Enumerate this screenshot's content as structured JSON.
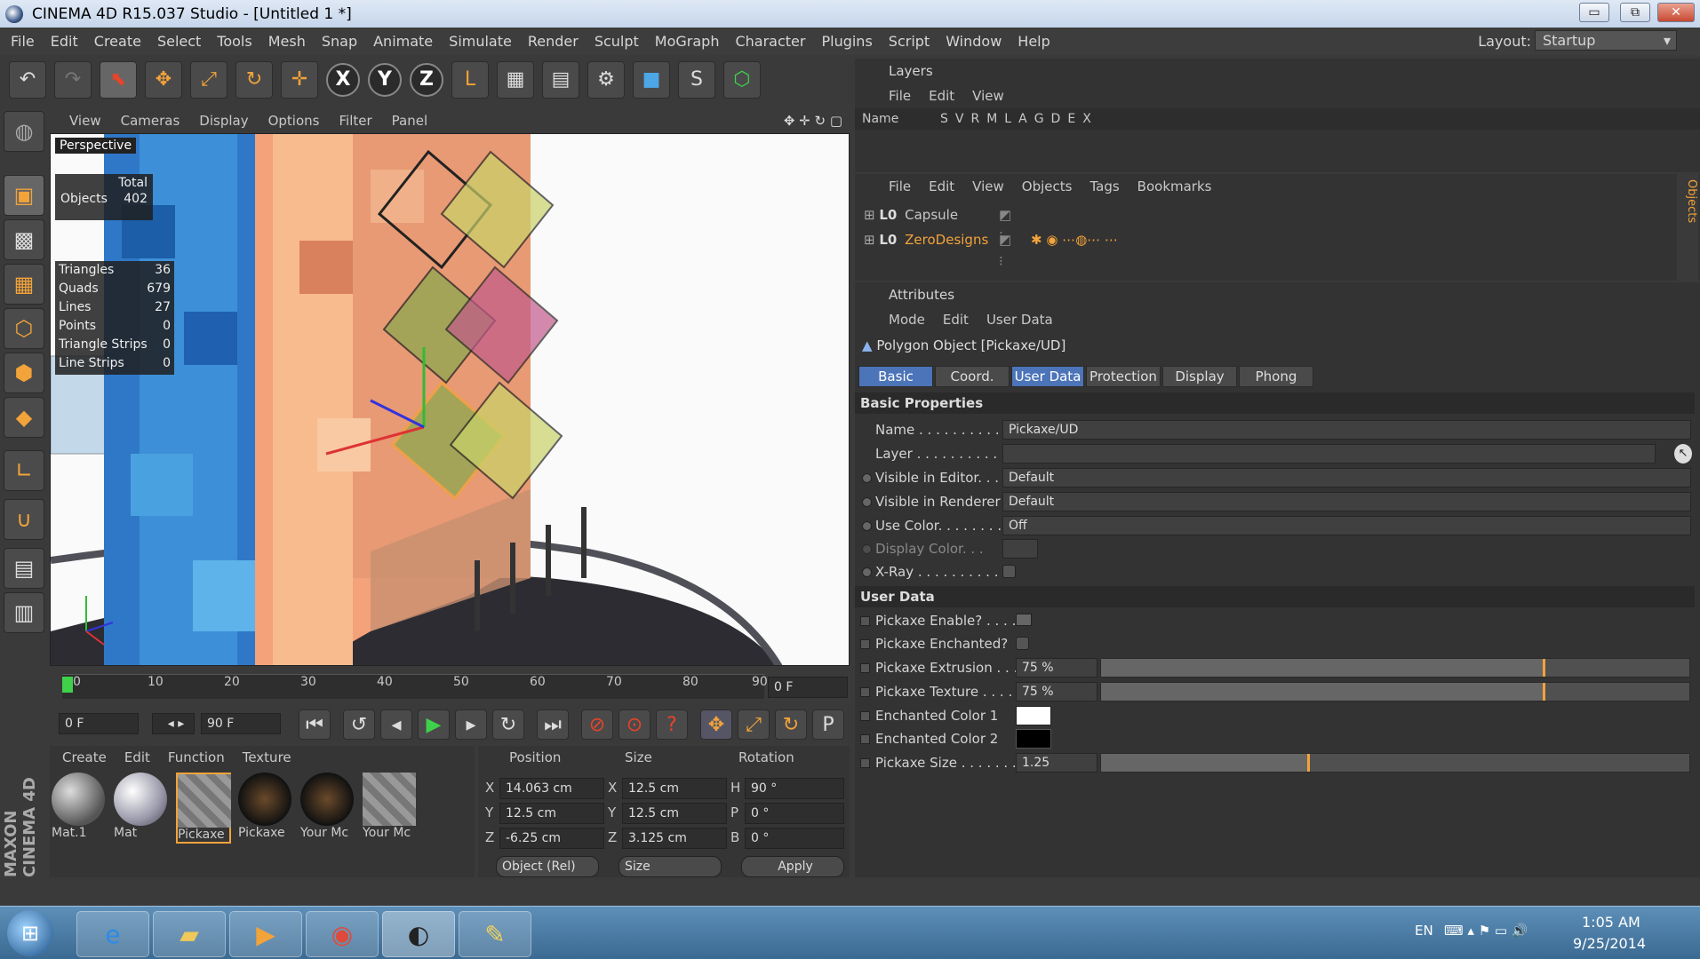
{
  "window": {
    "title": "CINEMA 4D R15.037 Studio - [Untitled 1 *]",
    "minimize": "▭",
    "restore": "⧉",
    "close": "✕"
  },
  "menubar": {
    "items": [
      "File",
      "Edit",
      "Create",
      "Select",
      "Tools",
      "Mesh",
      "Snap",
      "Animate",
      "Simulate",
      "Render",
      "Sculpt",
      "MoGraph",
      "Character",
      "Plugins",
      "Script",
      "Window",
      "Help"
    ],
    "layout_label": "Layout:",
    "layout_value": "Startup"
  },
  "toolbar": {
    "undo": "↶",
    "redo": "↷",
    "select": "⬉",
    "move": "✥",
    "scale": "⤢",
    "rotate": "↻",
    "live": "✛",
    "x_axis": "X",
    "y_axis": "Y",
    "z_axis": "Z",
    "coord": "L",
    "render_view": "▦",
    "render_pv": "▤",
    "render_settings": "⚙",
    "cube": "■",
    "spline": "S",
    "nurbs": "⬡"
  },
  "viewport": {
    "menu": [
      "View",
      "Cameras",
      "Display",
      "Options",
      "Filter",
      "Panel"
    ],
    "camera_label": "Perspective",
    "hud_total_header": "Total",
    "hud_objects_label": "Objects",
    "hud_objects_value": "402",
    "stats": [
      {
        "label": "Triangles",
        "value": "36"
      },
      {
        "label": "Quads",
        "value": "679"
      },
      {
        "label": "Lines",
        "value": "27"
      },
      {
        "label": "Points",
        "value": "0"
      },
      {
        "label": "Triangle Strips",
        "value": "0"
      },
      {
        "label": "Line Strips",
        "value": "0"
      }
    ]
  },
  "timeline": {
    "ticks": [
      "0",
      "10",
      "20",
      "30",
      "40",
      "50",
      "60",
      "70",
      "80",
      "90"
    ],
    "current_frame": "0 F",
    "start_frame": "0 F",
    "end_frame": "90 F"
  },
  "material_manager": {
    "menu": [
      "Create",
      "Edit",
      "Function",
      "Texture"
    ],
    "materials": [
      "Mat.1",
      "Mat",
      "Pickaxe",
      "Pickaxe",
      "Your Mc",
      "Your Mc"
    ],
    "brand_maxon": "MAXON",
    "brand_c4d": "CINEMA 4D"
  },
  "coord_manager": {
    "headers": [
      "Position",
      "Size",
      "Rotation"
    ],
    "rows": [
      {
        "axis": "X",
        "pos": "14.063 cm",
        "saxis": "X",
        "size": "12.5 cm",
        "raxis": "H",
        "rot": "90 °"
      },
      {
        "axis": "Y",
        "pos": "12.5 cm",
        "saxis": "Y",
        "size": "12.5 cm",
        "raxis": "P",
        "rot": "0 °"
      },
      {
        "axis": "Z",
        "pos": "-6.25 cm",
        "saxis": "Z",
        "size": "3.125 cm",
        "raxis": "B",
        "rot": "0 °"
      }
    ],
    "mode": "Object (Rel)",
    "size_mode": "Size",
    "apply": "Apply"
  },
  "layers": {
    "title": "Layers",
    "menu": [
      "File",
      "Edit",
      "View"
    ],
    "columns": [
      "Name",
      "S",
      "V",
      "R",
      "M",
      "L",
      "A",
      "G",
      "D",
      "E",
      "X"
    ]
  },
  "objects": {
    "menu": [
      "File",
      "Edit",
      "View",
      "Objects",
      "Tags",
      "Bookmarks"
    ],
    "items": [
      {
        "name": "Capsule",
        "color": "#cfcfcf"
      },
      {
        "name": "ZeroDesigns",
        "color": "#f2a33a"
      }
    ],
    "side_tab": "Objects"
  },
  "attributes": {
    "title": "Attributes",
    "menu": [
      "Mode",
      "Edit",
      "User Data"
    ],
    "object_title": "Polygon Object [Pickaxe/UD]",
    "tabs": [
      "Basic",
      "Coord.",
      "User Data",
      "Protection",
      "Display",
      "Phong"
    ],
    "basic_header": "Basic Properties",
    "basic": [
      {
        "label": "Name . . . . . . . . . . . . .",
        "value": "Pickaxe/UD"
      },
      {
        "label": "Layer . . . . . . . . . . . . .",
        "value": ""
      },
      {
        "label": "Visible in Editor. . .",
        "value": "Default"
      },
      {
        "label": "Visible in Renderer",
        "value": "Default"
      },
      {
        "label": "Use Color. . . . . . . . .",
        "value": "Off"
      },
      {
        "label": "Display Color. . .",
        "value": ""
      },
      {
        "label": "X-Ray . . . . . . . . . . .",
        "value": ""
      }
    ],
    "userdata_header": "User Data",
    "userdata": [
      {
        "label": "Pickaxe Enable? . . . . .",
        "value": ""
      },
      {
        "label": "Pickaxe Enchanted?",
        "value": ""
      },
      {
        "label": "Pickaxe Extrusion . . .",
        "value": "75 %",
        "level": 0.75
      },
      {
        "label": "Pickaxe Texture . . . . .",
        "value": "75 %",
        "level": 0.75
      },
      {
        "label": "Enchanted Color 1",
        "value": "",
        "color": "#ffffff"
      },
      {
        "label": "Enchanted Color 2",
        "value": "",
        "color": "#000000"
      },
      {
        "label": "Pickaxe Size . . . . . . . .",
        "value": "1.25",
        "level": 0.42
      }
    ]
  },
  "taskbar": {
    "lang": "EN",
    "time": "1:05 AM",
    "date": "9/25/2014"
  },
  "colors": {
    "accent": "#f2a33a",
    "active_tab": "#4c74b8",
    "panel": "#333333"
  }
}
